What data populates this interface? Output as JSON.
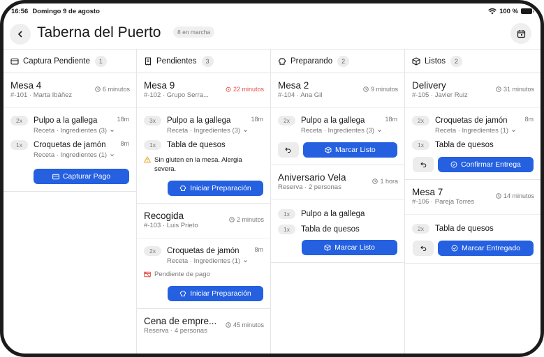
{
  "status_bar": {
    "time": "16:56",
    "date": "Domingo 9 de agosto",
    "battery": "100 %"
  },
  "header": {
    "title": "Taberna del Puerto",
    "status_chip": "8 en marcha"
  },
  "colors": {
    "accent": "#2460e0",
    "alert": "#e0524a",
    "muted": "#777777"
  },
  "columns": [
    {
      "title": "Captura Pendiente",
      "count": "1",
      "icon": "register-icon",
      "cards": [
        {
          "name": "Mesa 4",
          "sub": "#-101 · Marta Ibáñez",
          "timer": "6 minutos",
          "items": [
            {
              "qty": "2x",
              "name": "Pulpo a la gallega",
              "detail": "Receta · Ingredientes (3)",
              "time": "18m"
            },
            {
              "qty": "1x",
              "name": "Croquetas de jamón",
              "detail": "Receta · Ingredientes (1)",
              "time": "8m"
            }
          ],
          "action": "Capturar Pago"
        }
      ]
    },
    {
      "title": "Pendientes",
      "count": "3",
      "icon": "receipt-icon",
      "cards": [
        {
          "name": "Mesa 9",
          "sub": "#-102 · Grupo Serra...",
          "timer": "22 minutos",
          "items": [
            {
              "qty": "3x",
              "name": "Pulpo a la gallega",
              "detail": "Receta · Ingredientes (3)",
              "time": "18m"
            },
            {
              "qty": "1x",
              "name": "Tabla de quesos"
            }
          ],
          "note": "Sin gluten en la mesa. Alergia severa.",
          "action": "Iniciar Preparación"
        },
        {
          "name": "Recogida",
          "sub": "#-103 · Luis Prieto",
          "timer": "2 minutos",
          "items": [
            {
              "qty": "2x",
              "name": "Croquetas de jamón",
              "detail": "Receta · Ingredientes (1)",
              "time": "8m"
            }
          ],
          "payment_note": "Pendiente de pago",
          "action": "Iniciar Preparación"
        },
        {
          "name": "Cena de empre...",
          "sub": "Reserva · 4 personas",
          "timer": "45 minutos"
        }
      ]
    },
    {
      "title": "Preparando",
      "count": "2",
      "icon": "chef-hat-icon",
      "cards": [
        {
          "name": "Mesa 2",
          "sub": "#-104 · Ana Gil",
          "timer": "9 minutos",
          "items": [
            {
              "qty": "2x",
              "name": "Pulpo a la gallega",
              "detail": "Receta · Ingredientes (3)",
              "time": "18m"
            }
          ],
          "action": "Marcar Listo"
        },
        {
          "name": "Aniversario Vela",
          "sub": "Reserva · 2 personas",
          "timer": "1 hora",
          "items": [
            {
              "qty": "1x",
              "name": "Pulpo a la gallega"
            },
            {
              "qty": "1x",
              "name": "Tabla de quesos"
            }
          ],
          "action": "Marcar Listo"
        }
      ]
    },
    {
      "title": "Listos",
      "count": "2",
      "icon": "package-icon",
      "cards": [
        {
          "name": "Delivery",
          "sub": "#-105 · Javier Ruiz",
          "timer": "31 minutos",
          "items": [
            {
              "qty": "2x",
              "name": "Croquetas de jamón",
              "detail": "Receta · Ingredientes (1)",
              "time": "8m"
            },
            {
              "qty": "1x",
              "name": "Tabla de quesos"
            }
          ],
          "action": "Confirmar Entrega"
        },
        {
          "name": "Mesa 7",
          "sub": "#-106 · Pareja Torres",
          "timer": "14 minutos",
          "items": [
            {
              "qty": "2x",
              "name": "Tabla de quesos"
            }
          ],
          "action": "Marcar Entregado"
        }
      ]
    }
  ]
}
